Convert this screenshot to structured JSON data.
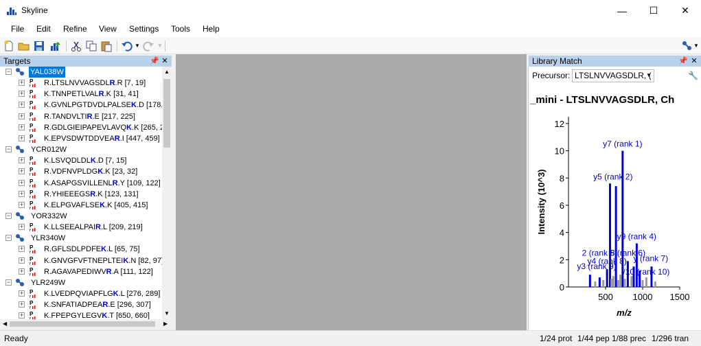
{
  "window": {
    "title": "Skyline",
    "min": "—",
    "max": "☐",
    "close": "✕"
  },
  "menu": [
    "File",
    "Edit",
    "Refine",
    "View",
    "Settings",
    "Tools",
    "Help"
  ],
  "targets_pane": {
    "title": "Targets",
    "proteins": [
      {
        "name": "YAL038W",
        "selected": true,
        "peptides": [
          {
            "pre": "R.LTSLNVVAGSDL",
            "bold": "R",
            "post": ".R [7, 19]"
          },
          {
            "pre": "K.TNNPETLVAL",
            "bold": "R",
            "post": ".K [31, 41]"
          },
          {
            "pre": "K.GVNLPGTDVDLPALSE",
            "bold": "K",
            "post": ".D [178,"
          },
          {
            "pre": "R.TANDVLTI",
            "bold": "R",
            "post": ".E [217, 225]"
          },
          {
            "pre": "R.GDLGIEIPAPEVLAVQ",
            "bold": "K",
            "post": ".K [265, 2"
          },
          {
            "pre": "K.EPVSDWTDDVEA",
            "bold": "R",
            "post": ".I [447, 459]"
          }
        ]
      },
      {
        "name": "YCR012W",
        "selected": false,
        "peptides": [
          {
            "pre": "K.LSVQDLDL",
            "bold": "K",
            "post": ".D [7, 15]"
          },
          {
            "pre": "R.VDFNVPLDG",
            "bold": "K",
            "post": ".K [23, 32]"
          },
          {
            "pre": "K.ASAPGSVILLENL",
            "bold": "R",
            "post": ".Y [109, 122]"
          },
          {
            "pre": "R.YHIEEEGS",
            "bold": "R",
            "post": ".K [123, 131]"
          },
          {
            "pre": "K.ELPGVAFLSE",
            "bold": "K",
            "post": ".K [405, 415]"
          }
        ]
      },
      {
        "name": "YOR332W",
        "selected": false,
        "peptides": [
          {
            "pre": "K.LLSEEALPAI",
            "bold": "R",
            "post": ".L [209, 219]"
          }
        ]
      },
      {
        "name": "YLR340W",
        "selected": false,
        "peptides": [
          {
            "pre": "R.GFLSDLPDFE",
            "bold": "K",
            "post": ".L [65, 75]"
          },
          {
            "pre": "K.GNVGFVFTNEPLTEI",
            "bold": "K",
            "post": ".N [82, 97]"
          },
          {
            "pre": "R.AGAVAPEDIWV",
            "bold": "R",
            "post": ".A [111, 122]"
          }
        ]
      },
      {
        "name": "YLR249W",
        "selected": false,
        "peptides": [
          {
            "pre": "K.LVEDPQVIAPFLG",
            "bold": "K",
            "post": ".L [276, 289]"
          },
          {
            "pre": "K.SNFATIADPEA",
            "bold": "R",
            "post": ".E [296, 307]"
          },
          {
            "pre": "K.FPEPGYLEGV",
            "bold": "K",
            "post": ".T [650, 660]"
          }
        ]
      }
    ]
  },
  "library_pane": {
    "title": "Library Match",
    "precursor_label": "Precursor:",
    "precursor_value": "LTSLNVVAGSDLR, ("
  },
  "chart_data": {
    "type": "bar",
    "title": "_mini - LTSLNVVAGSDLR, Ch",
    "xlabel": "m/z",
    "ylabel": "Intensity (10^3)",
    "xlim": [
      0,
      1500
    ],
    "ylim": [
      0,
      12.5
    ],
    "xticks": [
      500,
      1000,
      1500
    ],
    "yticks": [
      0,
      2,
      4,
      6,
      8,
      10,
      12
    ],
    "peaks": [
      {
        "x": 290,
        "y": 0.9,
        "color": "#0000dd"
      },
      {
        "x": 360,
        "y": 0.4,
        "color": "#9a9a9a"
      },
      {
        "x": 420,
        "y": 0.7,
        "color": "#0000dd"
      },
      {
        "x": 470,
        "y": 0.5,
        "color": "#9a9a9a"
      },
      {
        "x": 520,
        "y": 1.3,
        "color": "#0000dd"
      },
      {
        "x": 560,
        "y": 7.6,
        "color": "#0000dd"
      },
      {
        "x": 580,
        "y": 0.6,
        "color": "#9a9a9a"
      },
      {
        "x": 605,
        "y": 0.8,
        "color": "#9a9a9a"
      },
      {
        "x": 640,
        "y": 7.4,
        "color": "#0000dd"
      },
      {
        "x": 670,
        "y": 0.5,
        "color": "#9a9a9a"
      },
      {
        "x": 700,
        "y": 0.9,
        "color": "#9a9a9a"
      },
      {
        "x": 730,
        "y": 10.0,
        "color": "#0000dd"
      },
      {
        "x": 760,
        "y": 0.6,
        "color": "#9a9a9a"
      },
      {
        "x": 800,
        "y": 1.9,
        "color": "#0000dd"
      },
      {
        "x": 850,
        "y": 0.8,
        "color": "#9a9a9a"
      },
      {
        "x": 880,
        "y": 1.5,
        "color": "#0000dd"
      },
      {
        "x": 920,
        "y": 3.2,
        "color": "#0000dd"
      },
      {
        "x": 960,
        "y": 1.2,
        "color": "#0000dd"
      },
      {
        "x": 1000,
        "y": 0.5,
        "color": "#9a9a9a"
      },
      {
        "x": 1050,
        "y": 0.7,
        "color": "#9a9a9a"
      },
      {
        "x": 1120,
        "y": 1.5,
        "color": "#0000dd"
      },
      {
        "x": 1170,
        "y": 0.4,
        "color": "#9a9a9a"
      }
    ],
    "annotations": [
      {
        "text": "y7 (rank 1)",
        "x": 730,
        "y": 10.3
      },
      {
        "text": "y5 (rank 2)",
        "x": 600,
        "y": 7.9
      },
      {
        "text": "y9 (rank 4)",
        "x": 920,
        "y": 3.5
      },
      {
        "text": "2 (rank 5)",
        "x": 420,
        "y": 2.3
      },
      {
        "text": "8 (rank 6)",
        "x": 800,
        "y": 2.3
      },
      {
        "text": "y (rank 7)",
        "x": 1110,
        "y": 1.9
      },
      {
        "text": "y4 (rank 8)",
        "x": 520,
        "y": 1.7
      },
      {
        "text": "y3 (rank 9)",
        "x": 380,
        "y": 1.3
      },
      {
        "text": "/10 (rank 10)",
        "x": 1050,
        "y": 0.9
      }
    ]
  },
  "status": {
    "left": "Ready",
    "prot": "1/24 prot",
    "pep": "1/44 pep",
    "prec": "1/88 prec",
    "tran": "1/296 tran"
  }
}
